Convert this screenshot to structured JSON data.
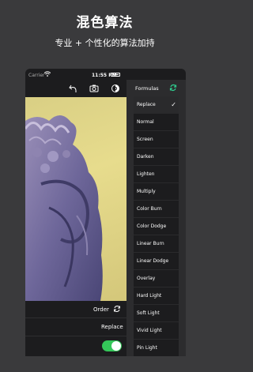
{
  "promo": {
    "title": "混色算法",
    "subtitle": "专业 + 个性化的算法加持"
  },
  "statusbar": {
    "carrier": "Carrier",
    "time": "11:55 PM"
  },
  "toolbar": {
    "icons": [
      "undo-icon",
      "camera-icon",
      "compare-icon"
    ]
  },
  "formulas": {
    "title": "Formulas",
    "items": [
      {
        "label": "Replace",
        "selected": true
      },
      {
        "label": "Normal"
      },
      {
        "label": "Screen"
      },
      {
        "label": "Darken"
      },
      {
        "label": "Lighten"
      },
      {
        "label": "Multiply"
      },
      {
        "label": "Color Burn"
      },
      {
        "label": "Color Dodge"
      },
      {
        "label": "Linear Burn"
      },
      {
        "label": "Linear Dodge"
      },
      {
        "label": "Overlay"
      },
      {
        "label": "Hard Light"
      },
      {
        "label": "Soft Light"
      },
      {
        "label": "Vivid Light"
      },
      {
        "label": "Pin Light"
      }
    ],
    "checkmark": "✓"
  },
  "settings": {
    "order_label": "Order",
    "replace_value": "Replace",
    "toggle_on": true
  },
  "colors": {
    "accent": "#34c759",
    "refresh_icon": "#2fd191",
    "background": "#3a3a3c"
  }
}
